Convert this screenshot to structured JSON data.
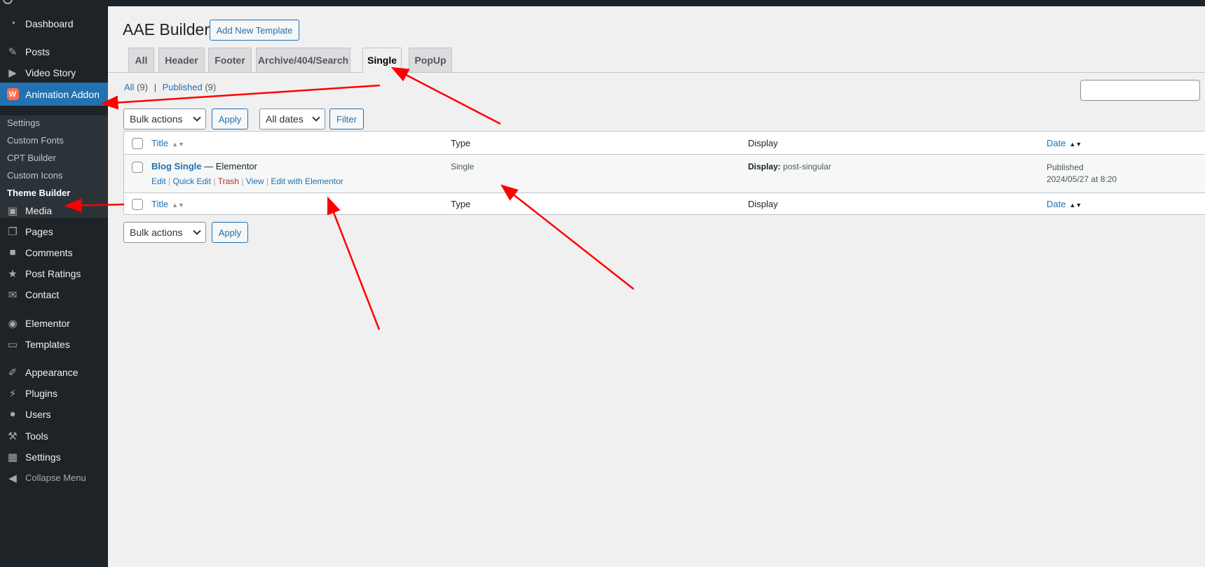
{
  "sidebar": {
    "menu": [
      {
        "label": "Dashboard",
        "icon": "dashboard-icon"
      },
      {
        "label": "Posts",
        "icon": "pin-icon"
      },
      {
        "label": "Video Story",
        "icon": "video-icon"
      },
      {
        "label": "Animation Addon",
        "icon": "animation-addon-icon",
        "active": true
      },
      {
        "label": "Media",
        "icon": "media-icon"
      },
      {
        "label": "Pages",
        "icon": "pages-icon"
      },
      {
        "label": "Comments",
        "icon": "comments-icon"
      },
      {
        "label": "Post Ratings",
        "icon": "star-icon"
      },
      {
        "label": "Contact",
        "icon": "mail-icon"
      },
      {
        "label": "Elementor",
        "icon": "elementor-icon"
      },
      {
        "label": "Templates",
        "icon": "folder-icon"
      },
      {
        "label": "Appearance",
        "icon": "brush-icon"
      },
      {
        "label": "Plugins",
        "icon": "plugin-icon"
      },
      {
        "label": "Users",
        "icon": "user-icon"
      },
      {
        "label": "Tools",
        "icon": "wrench-icon"
      },
      {
        "label": "Settings",
        "icon": "settings-icon"
      },
      {
        "label": "Collapse Menu",
        "icon": "collapse-icon"
      }
    ],
    "submenu": [
      {
        "label": "Settings"
      },
      {
        "label": "Custom Fonts"
      },
      {
        "label": "CPT Builder"
      },
      {
        "label": "Custom Icons"
      },
      {
        "label": "Theme Builder",
        "current": true
      }
    ]
  },
  "header": {
    "title": "AAE Builder",
    "add_new_label": "Add New Template"
  },
  "tabs": [
    {
      "label": "All"
    },
    {
      "label": "Header"
    },
    {
      "label": "Footer"
    },
    {
      "label": "Archive/404/Search"
    },
    {
      "label": "Single",
      "active": true
    },
    {
      "label": "PopUp"
    }
  ],
  "views": {
    "all_label": "All",
    "all_count": "(9)",
    "separator": "|",
    "published_label": "Published",
    "published_count": "(9)"
  },
  "filters": {
    "bulk_actions": "Bulk actions",
    "apply": "Apply",
    "dates": "All dates",
    "filter": "Filter"
  },
  "table": {
    "columns": {
      "title": "Title",
      "type": "Type",
      "display": "Display",
      "date": "Date"
    },
    "rows": [
      {
        "title": "Blog Single",
        "title_suffix": "— Elementor",
        "actions": [
          "Edit",
          "Quick Edit",
          "Trash",
          "View",
          "Edit with Elementor"
        ],
        "type": "Single",
        "display_label": "Display:",
        "display_value": "post-singular",
        "status": "Published",
        "date": "2024/05/27 at 8:20"
      }
    ]
  },
  "bottom": {
    "bulk_actions": "Bulk actions",
    "apply": "Apply"
  },
  "colors": {
    "accent": "#2271b1",
    "sidebar": "#1d2327",
    "annotation": "#ff0000",
    "trash": "#b32d2e"
  }
}
